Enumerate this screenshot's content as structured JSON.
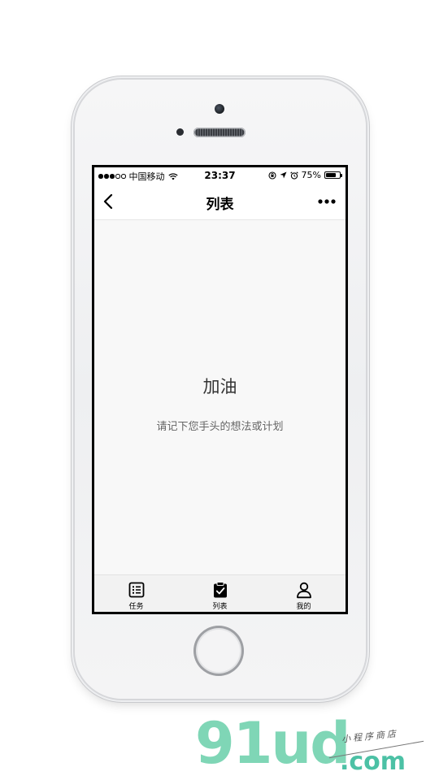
{
  "status_bar": {
    "carrier": "中国移动",
    "time": "23:37",
    "battery_percent_label": "75%",
    "battery_level": 0.75,
    "signal_bars": 3,
    "signal_total": 5
  },
  "nav": {
    "title": "列表",
    "back_icon": "chevron-left-icon",
    "more_icon": "more-horizontal-icon"
  },
  "empty_state": {
    "title": "加油",
    "subtitle": "请记下您手头的想法或计划"
  },
  "tab_bar": {
    "tabs": [
      {
        "label": "任务",
        "icon": "task-list-icon"
      },
      {
        "label": "列表",
        "icon": "clipboard-check-icon",
        "active": true
      },
      {
        "label": "我的",
        "icon": "person-icon"
      }
    ]
  },
  "watermark": {
    "logo": "91ud",
    "suffix": ".com",
    "tagline": "小程序商店",
    "accent_color": "#7fd6b6"
  },
  "colors": {
    "screen_background": "#f8f8f8",
    "nav_background": "#ffffff",
    "tab_bar_background": "#f2f2f2",
    "text_primary": "#333333",
    "text_secondary": "#666666"
  }
}
